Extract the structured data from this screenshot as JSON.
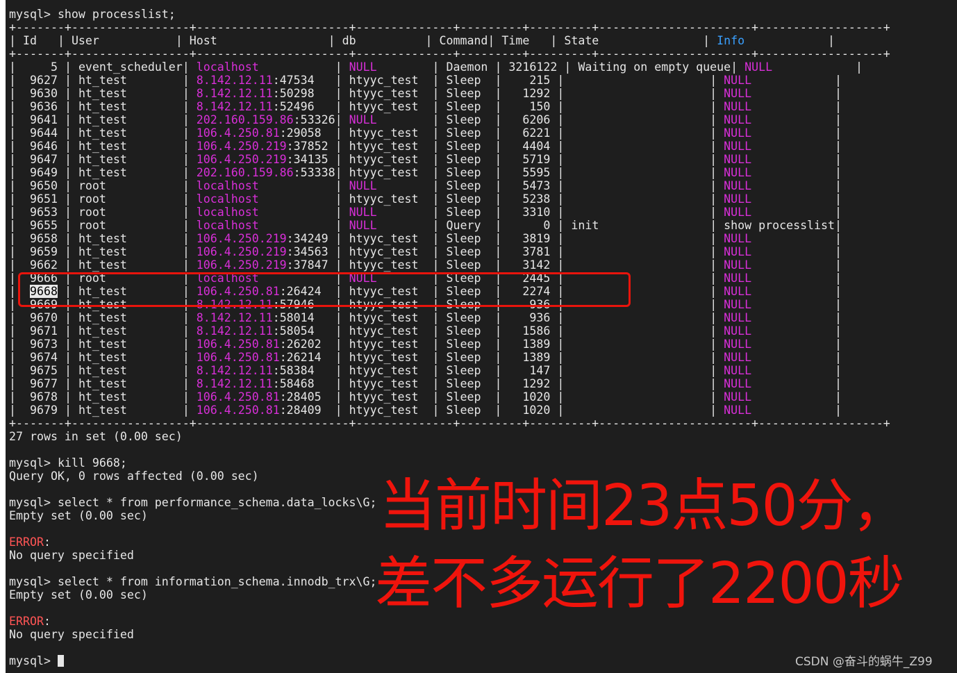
{
  "terminal": {
    "prompt": "mysql> ",
    "command1": "show processlist;",
    "border": "+-------+-----------------+----------------------+--------------+---------+---------+----------------------+------------------+",
    "columns": [
      "Id",
      "User",
      "Host",
      "db",
      "Command",
      "Time",
      "State",
      "Info"
    ],
    "rows": [
      {
        "id": "5",
        "user": "event_scheduler",
        "host": "localhost",
        "port": "",
        "db": "NULL",
        "command": "Daemon",
        "time": "3216122",
        "state": "Waiting on empty queue",
        "info": "NULL"
      },
      {
        "id": "9627",
        "user": "ht_test",
        "host": "8.142.12.11",
        "port": ":47534",
        "db": "htyyc_test",
        "command": "Sleep",
        "time": "215",
        "state": "",
        "info": "NULL"
      },
      {
        "id": "9630",
        "user": "ht_test",
        "host": "8.142.12.11",
        "port": ":50298",
        "db": "htyyc_test",
        "command": "Sleep",
        "time": "1292",
        "state": "",
        "info": "NULL"
      },
      {
        "id": "9636",
        "user": "ht_test",
        "host": "8.142.12.11",
        "port": ":52496",
        "db": "htyyc_test",
        "command": "Sleep",
        "time": "150",
        "state": "",
        "info": "NULL"
      },
      {
        "id": "9641",
        "user": "ht_test",
        "host": "202.160.159.86",
        "port": ":53326",
        "db": "NULL",
        "command": "Sleep",
        "time": "6206",
        "state": "",
        "info": "NULL"
      },
      {
        "id": "9644",
        "user": "ht_test",
        "host": "106.4.250.81",
        "port": ":29058",
        "db": "htyyc_test",
        "command": "Sleep",
        "time": "6221",
        "state": "",
        "info": "NULL"
      },
      {
        "id": "9646",
        "user": "ht_test",
        "host": "106.4.250.219",
        "port": ":37852",
        "db": "htyyc_test",
        "command": "Sleep",
        "time": "4404",
        "state": "",
        "info": "NULL"
      },
      {
        "id": "9647",
        "user": "ht_test",
        "host": "106.4.250.219",
        "port": ":34135",
        "db": "htyyc_test",
        "command": "Sleep",
        "time": "5719",
        "state": "",
        "info": "NULL"
      },
      {
        "id": "9649",
        "user": "ht_test",
        "host": "202.160.159.86",
        "port": ":53338",
        "db": "htyyc_test",
        "command": "Sleep",
        "time": "5595",
        "state": "",
        "info": "NULL"
      },
      {
        "id": "9650",
        "user": "root",
        "host": "localhost",
        "port": "",
        "db": "NULL",
        "command": "Sleep",
        "time": "5473",
        "state": "",
        "info": "NULL"
      },
      {
        "id": "9651",
        "user": "root",
        "host": "localhost",
        "port": "",
        "db": "htyyc_test",
        "command": "Sleep",
        "time": "5238",
        "state": "",
        "info": "NULL"
      },
      {
        "id": "9653",
        "user": "root",
        "host": "localhost",
        "port": "",
        "db": "NULL",
        "command": "Sleep",
        "time": "3310",
        "state": "",
        "info": "NULL"
      },
      {
        "id": "9655",
        "user": "root",
        "host": "localhost",
        "port": "",
        "db": "NULL",
        "command": "Query",
        "time": "0",
        "state": "init",
        "info": "show processlist"
      },
      {
        "id": "9658",
        "user": "ht_test",
        "host": "106.4.250.219",
        "port": ":34249",
        "db": "htyyc_test",
        "command": "Sleep",
        "time": "3819",
        "state": "",
        "info": "NULL"
      },
      {
        "id": "9659",
        "user": "ht_test",
        "host": "106.4.250.219",
        "port": ":34563",
        "db": "htyyc_test",
        "command": "Sleep",
        "time": "3781",
        "state": "",
        "info": "NULL"
      },
      {
        "id": "9662",
        "user": "ht_test",
        "host": "106.4.250.219",
        "port": ":37847",
        "db": "htyyc_test",
        "command": "Sleep",
        "time": "3142",
        "state": "",
        "info": "NULL"
      },
      {
        "id": "9666",
        "user": "root",
        "host": "localhost",
        "port": "",
        "db": "NULL",
        "command": "Sleep",
        "time": "2445",
        "state": "",
        "info": "NULL"
      },
      {
        "id": "9668",
        "user": "ht_test",
        "host": "106.4.250.81",
        "port": ":26424",
        "db": "htyyc_test",
        "command": "Sleep",
        "time": "2274",
        "state": "",
        "info": "NULL",
        "selected": true
      },
      {
        "id": "9669",
        "user": "ht_test",
        "host": "8.142.12.11",
        "port": ":57946",
        "db": "htyyc_test",
        "command": "Sleep",
        "time": "936",
        "state": "",
        "info": "NULL"
      },
      {
        "id": "9670",
        "user": "ht_test",
        "host": "8.142.12.11",
        "port": ":58014",
        "db": "htyyc_test",
        "command": "Sleep",
        "time": "936",
        "state": "",
        "info": "NULL"
      },
      {
        "id": "9671",
        "user": "ht_test",
        "host": "8.142.12.11",
        "port": ":58054",
        "db": "htyyc_test",
        "command": "Sleep",
        "time": "1586",
        "state": "",
        "info": "NULL"
      },
      {
        "id": "9673",
        "user": "ht_test",
        "host": "106.4.250.81",
        "port": ":26202",
        "db": "htyyc_test",
        "command": "Sleep",
        "time": "1389",
        "state": "",
        "info": "NULL"
      },
      {
        "id": "9674",
        "user": "ht_test",
        "host": "106.4.250.81",
        "port": ":26214",
        "db": "htyyc_test",
        "command": "Sleep",
        "time": "1389",
        "state": "",
        "info": "NULL"
      },
      {
        "id": "9675",
        "user": "ht_test",
        "host": "8.142.12.11",
        "port": ":58384",
        "db": "htyyc_test",
        "command": "Sleep",
        "time": "147",
        "state": "",
        "info": "NULL"
      },
      {
        "id": "9677",
        "user": "ht_test",
        "host": "8.142.12.11",
        "port": ":58468",
        "db": "htyyc_test",
        "command": "Sleep",
        "time": "1292",
        "state": "",
        "info": "NULL"
      },
      {
        "id": "9678",
        "user": "ht_test",
        "host": "106.4.250.81",
        "port": ":28405",
        "db": "htyyc_test",
        "command": "Sleep",
        "time": "1020",
        "state": "",
        "info": "NULL"
      },
      {
        "id": "9679",
        "user": "ht_test",
        "host": "106.4.250.81",
        "port": ":28409",
        "db": "htyyc_test",
        "command": "Sleep",
        "time": "1020",
        "state": "",
        "info": "NULL"
      }
    ],
    "summary": "27 rows in set (0.00 sec)",
    "command2": "kill 9668;",
    "result2": "Query OK, 0 rows affected (0.00 sec)",
    "command3": "select * from performance_schema.data_locks\\G;",
    "result3": "Empty set (0.00 sec)",
    "error_label": "ERROR",
    "error_colon": ":",
    "error_message": "No query specified",
    "command4": "select * from information_schema.innodb_trx\\G;",
    "result4": "Empty set (0.00 sec)"
  },
  "annotation": {
    "line1": "当前时间23点50分，",
    "line2": "差不多运行了2200秒"
  },
  "watermark": "CSDN @奋斗的蜗牛_Z99",
  "colors": {
    "background": "#1e1e1e",
    "text": "#e6e6e6",
    "highlight": "#d82fd8",
    "info_header": "#3aa0ff",
    "error": "#ff5555",
    "annotation": "#f0140c"
  }
}
